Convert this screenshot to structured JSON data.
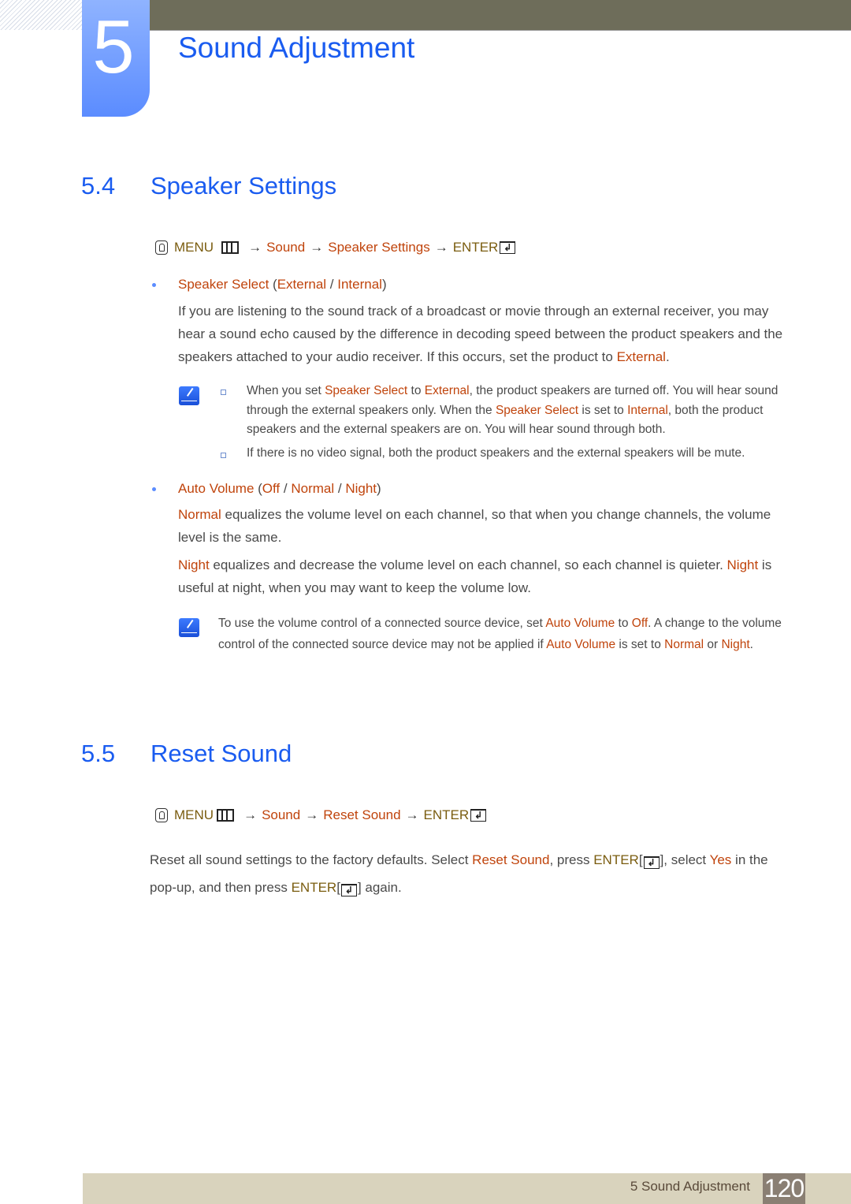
{
  "chapter": {
    "number": "5",
    "title": "Sound Adjustment"
  },
  "section_4": {
    "number": "5.4",
    "title": "Speaker Settings",
    "menu_path": {
      "menu": "MENU",
      "step1": "Sound",
      "step2": "Speaker Settings",
      "enter": "ENTER",
      "arrow": "→"
    },
    "speaker_select": {
      "label": "Speaker Select",
      "open_paren": " (",
      "option1": "External",
      "separator": " / ",
      "option2": "Internal",
      "close_paren": ")",
      "description_1": "If you are listening to the sound track of a broadcast or movie through an external receiver, you may hear a sound echo caused by the difference in decoding speed between the product speakers and the speakers attached to your audio receiver. If this occurs, set the product to ",
      "description_hl": "External",
      "description_end": ".",
      "notes": [
        {
          "t1": "When you set ",
          "h1": "Speaker Select",
          "t2": " to ",
          "h2": "External",
          "t3": ", the product speakers are turned off. You will hear sound through the external speakers only. When the ",
          "h3": "Speaker Select",
          "t4": " is set to ",
          "h4": "Internal",
          "t5": ", both the product speakers and the external speakers are on. You will hear sound through both."
        },
        {
          "t1": "If there is no video signal, both the product speakers and the external speakers will be mute."
        }
      ]
    },
    "auto_volume": {
      "label": "Auto Volume",
      "open_paren": " (",
      "option1": "Off",
      "separator": " / ",
      "option2": "Normal",
      "option3": "Night",
      "close_paren": ")",
      "normal_hl": "Normal",
      "normal_desc": " equalizes the volume level on each channel, so that when you change channels, the volume level is the same.",
      "night_hl": "Night",
      "night_desc": " equalizes and decrease the volume level on each channel, so each channel is quieter. ",
      "night_hl2": "Night",
      "night_desc2": " is useful at night, when you may want to keep the volume low.",
      "note": {
        "t1": "To use the volume control of a connected source device, set ",
        "h1": "Auto Volume",
        "t2": " to ",
        "h2": "Off",
        "t3": ". A change to the volume control of the connected source device may not be applied if ",
        "h3": "Auto Volume",
        "t4": " is set to ",
        "h4": "Normal",
        "t5": " or ",
        "h5": "Night",
        "t6": "."
      }
    }
  },
  "section_5": {
    "number": "5.5",
    "title": "Reset Sound",
    "menu_path": {
      "menu": "MENU",
      "step1": "Sound",
      "step2": "Reset Sound",
      "enter": "ENTER",
      "arrow": "→"
    },
    "body": {
      "t1": "Reset all sound settings to the factory defaults. Select ",
      "h1": "Reset Sound",
      "t2": ", press ",
      "enter1": "ENTER",
      "t3": "], select ",
      "h2": "Yes",
      "t4": " in the pop-up, and then press ",
      "enter2": "ENTER",
      "t5": "] again.",
      "bracket_open": "["
    }
  },
  "footer": {
    "label": "5 Sound Adjustment",
    "page": "120"
  }
}
